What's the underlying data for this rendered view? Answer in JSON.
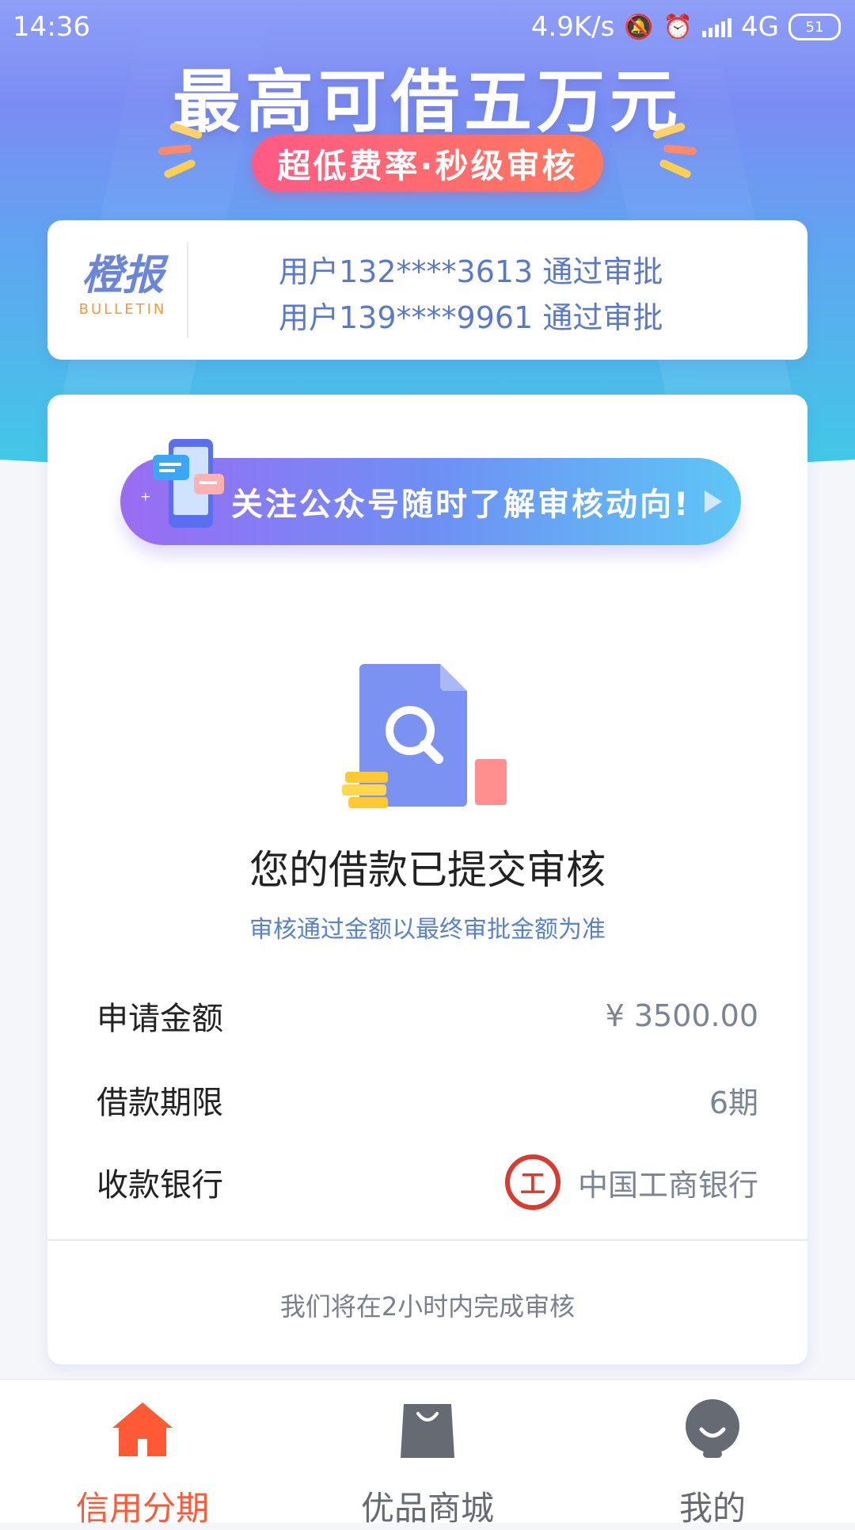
{
  "status_bar": {
    "time": "14:36",
    "speed": "4.9K/s",
    "network": "4G",
    "battery": "51"
  },
  "hero": {
    "headline": "最高可借五万元",
    "pill": "超低费率·秒级审核"
  },
  "bulletin": {
    "logo_cn": "橙报",
    "logo_en": "BULLETIN",
    "lines": [
      "用户132****3613 通过审批",
      "用户139****9961 通过审批"
    ]
  },
  "banner": {
    "text": "关注公众号随时了解审核动向!"
  },
  "status_card": {
    "title": "您的借款已提交审核",
    "subtitle": "审核通过金额以最终审批金额为准",
    "rows": [
      {
        "label": "申请金额",
        "value": "¥ 3500.00"
      },
      {
        "label": "借款期限",
        "value": "6期"
      },
      {
        "label": "收款银行",
        "value": "中国工商银行"
      }
    ],
    "footnote": "我们将在2小时内完成审核"
  },
  "tabbar": {
    "tabs": [
      {
        "label": "信用分期",
        "icon": "home-icon",
        "active": true
      },
      {
        "label": "优品商城",
        "icon": "shopping-bag-icon",
        "active": false
      },
      {
        "label": "我的",
        "icon": "profile-icon",
        "active": false
      }
    ]
  },
  "colors": {
    "accent": "#ff5a36",
    "inactive_tab": "#666a73",
    "link_blue": "#5a82c9"
  }
}
